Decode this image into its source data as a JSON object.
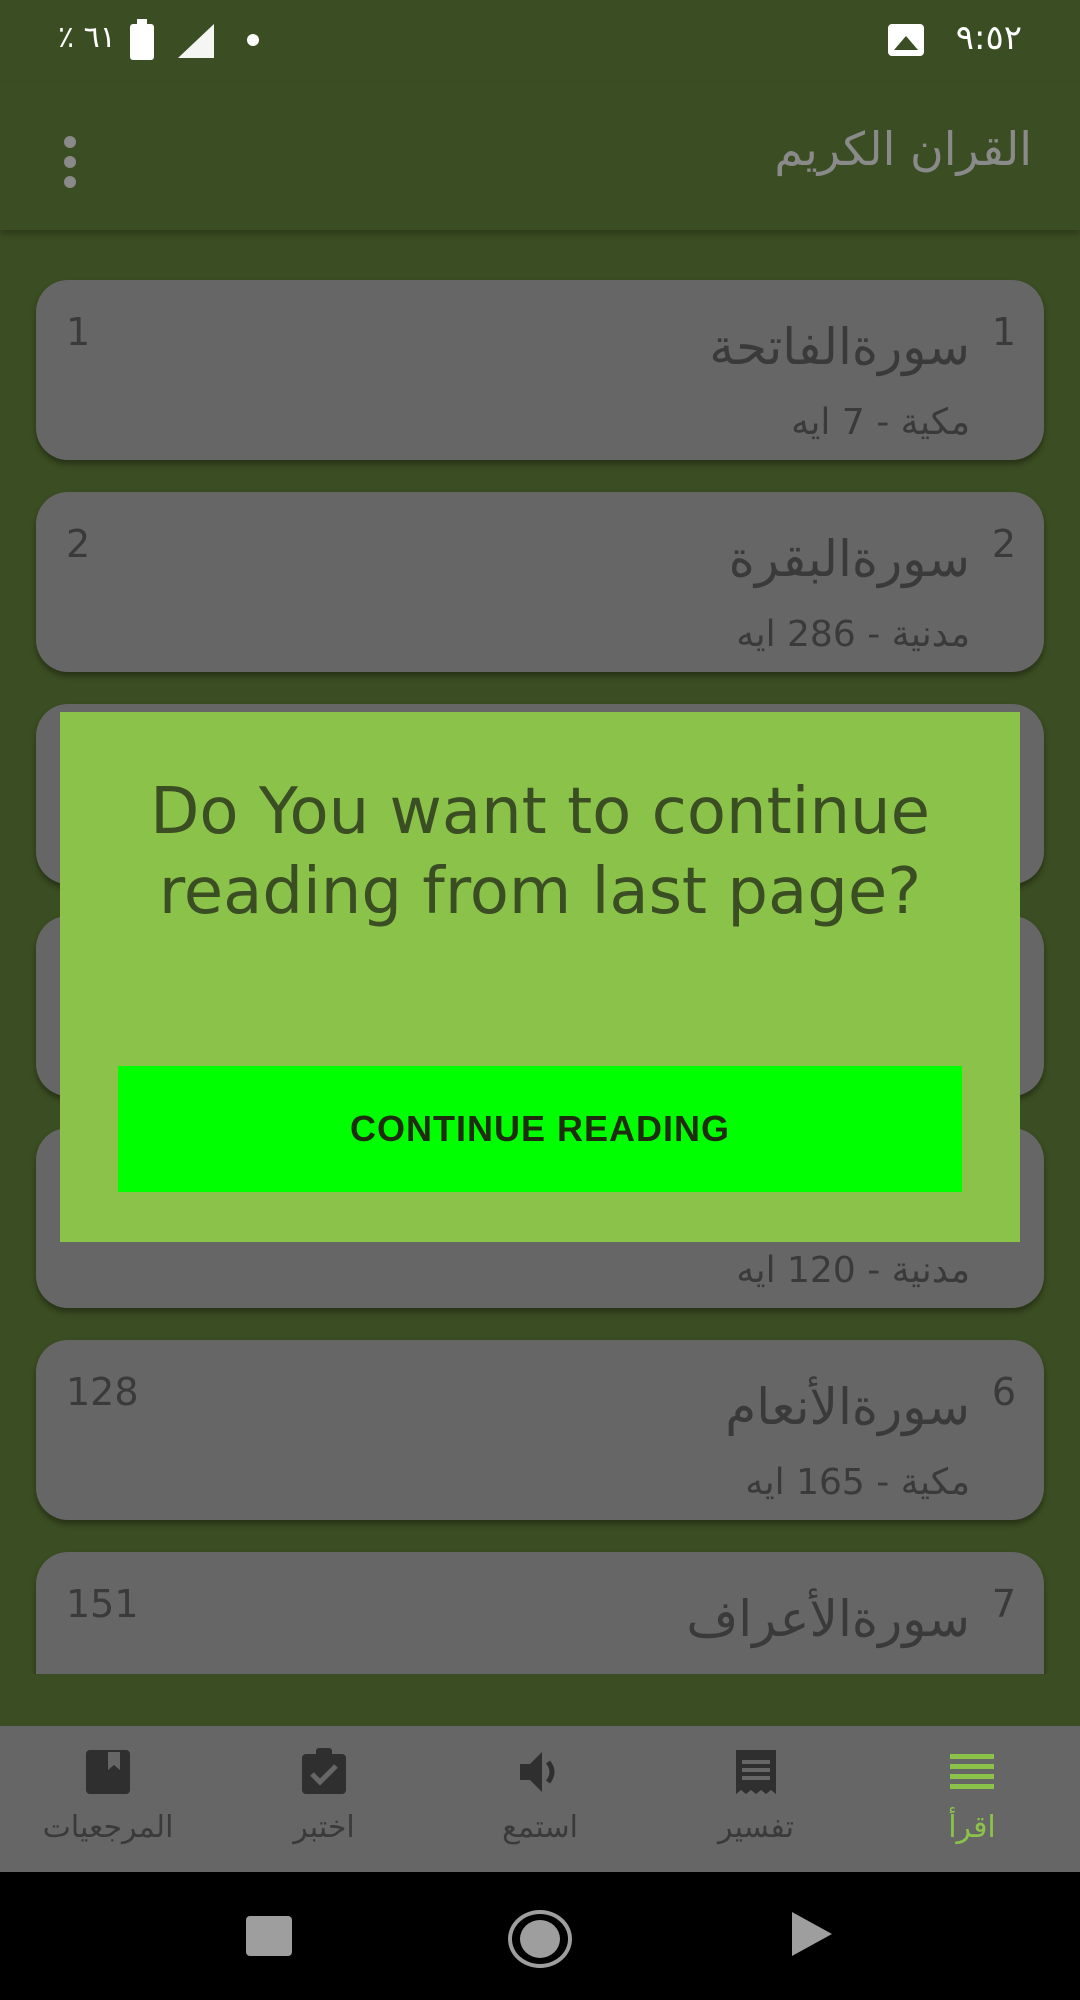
{
  "status_bar": {
    "time": "٩:٥٢",
    "battery_percent": "٪ ٦١"
  },
  "app_bar": {
    "title": "القران الكريم"
  },
  "surahs": [
    {
      "index": "1",
      "name": "سورةالفاتحة",
      "meta": "مكية  -  7 ايه",
      "page": "1"
    },
    {
      "index": "2",
      "name": "سورةالبقرة",
      "meta": "مدنية  -  286 ايه",
      "page": "2"
    },
    {
      "index": "",
      "name": "",
      "meta": "",
      "page": ""
    },
    {
      "index": "",
      "name": "",
      "meta": "",
      "page": ""
    },
    {
      "index": "",
      "name": "",
      "meta": "مدنية  -  120 ايه",
      "page": ""
    },
    {
      "index": "6",
      "name": "سورةالأنعام",
      "meta": "مكية  -  165 ايه",
      "page": "128"
    },
    {
      "index": "7",
      "name": "سورةالأعراف",
      "meta": "",
      "page": "151"
    }
  ],
  "dialog": {
    "message": "Do You want to continue reading from last page?",
    "button_label": "CONTINUE READING"
  },
  "bottom_nav": {
    "items": [
      {
        "label": "المرجعيات",
        "icon": "book-bookmark-icon"
      },
      {
        "label": "اختبر",
        "icon": "clipboard-check-icon"
      },
      {
        "label": "استمع",
        "icon": "speaker-icon"
      },
      {
        "label": "تفسير",
        "icon": "receipt-icon"
      },
      {
        "label": "اقرأ",
        "icon": "list-lines-icon",
        "active": true
      }
    ]
  },
  "colors": {
    "primary_dark": "#3b4d22",
    "dialog_bg": "#8bc34a",
    "button_bg": "#00ff00",
    "card_bg": "#666666"
  }
}
